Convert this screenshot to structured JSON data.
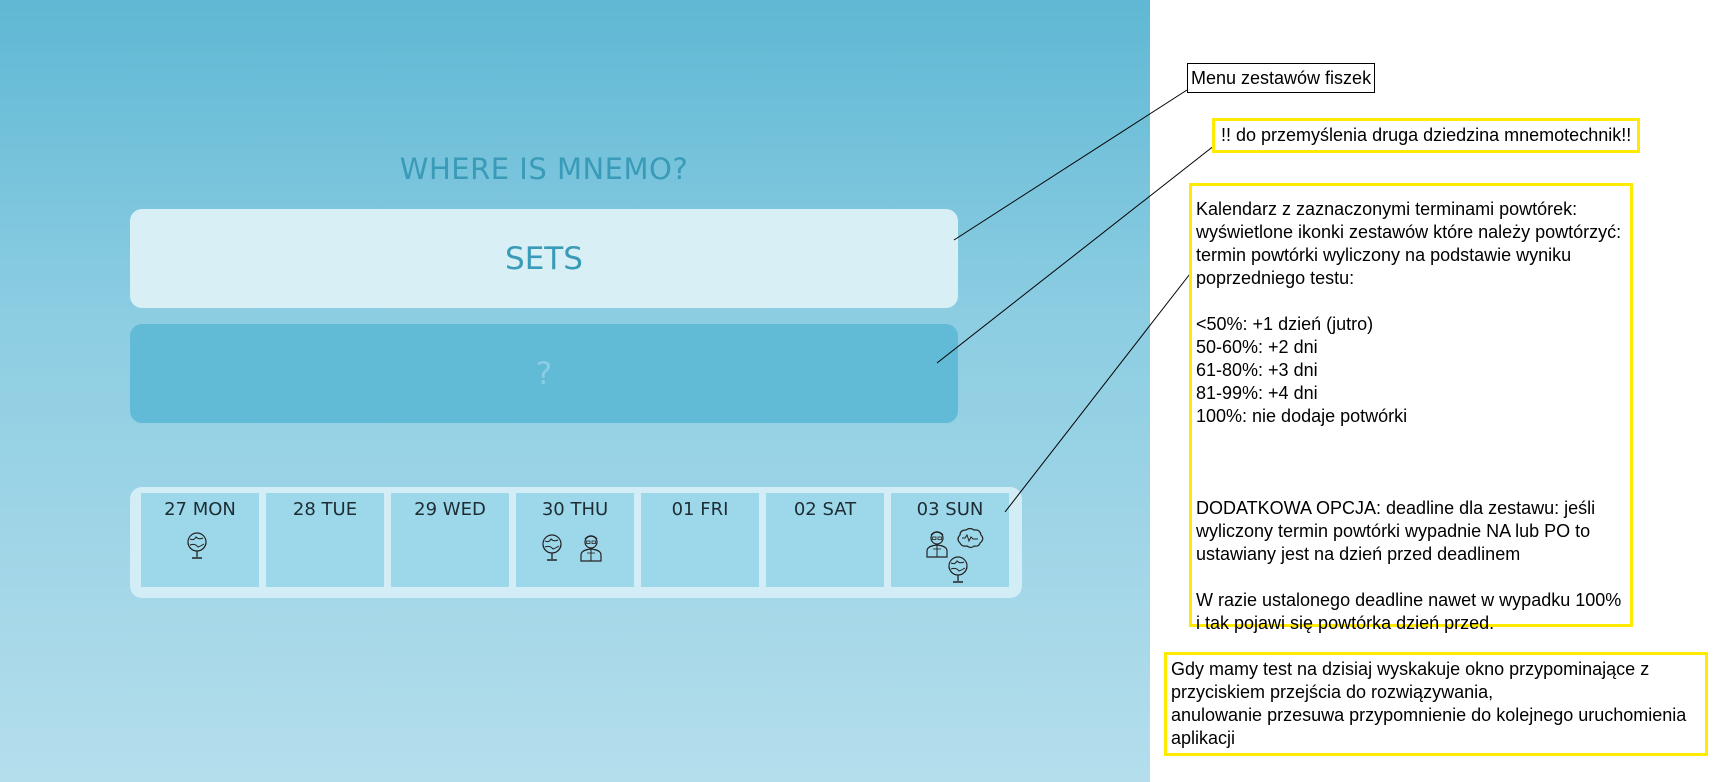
{
  "app": {
    "title": "WHERE IS MNEMO?",
    "buttons": {
      "sets_label": "SETS",
      "unknown_label": "?"
    },
    "calendar": {
      "days": [
        {
          "label": "27 MON",
          "icons": [
            "globe-icon"
          ]
        },
        {
          "label": "28 TUE",
          "icons": []
        },
        {
          "label": "29 WED",
          "icons": []
        },
        {
          "label": "30 THU",
          "icons": [
            "globe-icon",
            "scientist-icon"
          ]
        },
        {
          "label": "01 FRI",
          "icons": []
        },
        {
          "label": "02 SAT",
          "icons": []
        },
        {
          "label": "03 SUN",
          "icons": [
            "scientist-icon",
            "brain-icon",
            "globe-icon"
          ]
        }
      ]
    },
    "colors": {
      "title": "#3a9bb8",
      "sets_button": "#d7eff5",
      "unknown_button": "#62bbd6",
      "day_cell": "#9dd8ea",
      "calendar_bg": "#d2edf5",
      "note_border": "#ffea00"
    }
  },
  "annotations": {
    "menu": "Menu zestawów fiszek",
    "mnemo": "!! do przemyślenia druga dziedzina mnemotechnik!!",
    "calendar": "Kalendarz z zaznaczonymi terminami powtórek: wyświetlone ikonki zestawów które należy powtórzyć: termin powtórki wyliczony na podstawie wyniku poprzedniego testu:\n\n<50%: +1 dzień (jutro)\n50-60%: +2 dni\n61-80%: +3 dni\n81-99%: +4 dni\n100%: nie dodaje potwórki\n\n\n\nDODATKOWA OPCJA: deadline dla zestawu: jeśli wyliczony termin powtórki wypadnie NA lub PO to ustawiany jest na dzień przed deadlinem\n\nW razie ustalonego deadline nawet w wypadku 100% i tak pojawi się powtórka dzień przed.",
    "reminder": "Gdy mamy test na dzisiaj wyskakuje okno przypominające z przyciskiem przejścia do rozwiązywania,\nanulowanie przesuwa przypomnienie do kolejnego uruchomienia aplikacji"
  }
}
